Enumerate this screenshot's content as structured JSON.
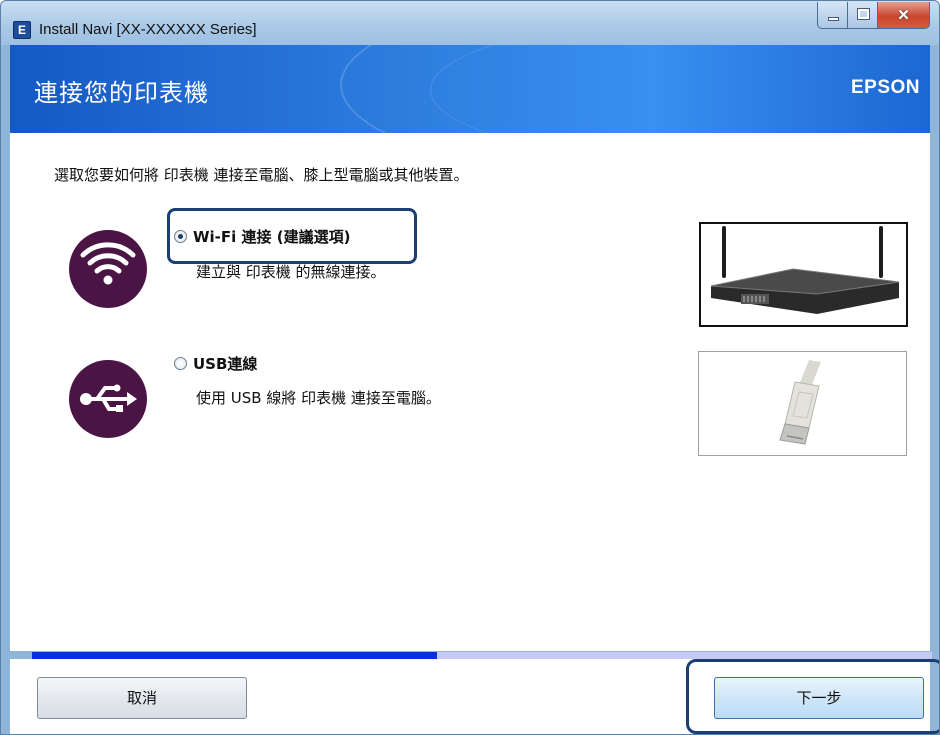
{
  "window": {
    "title": "Install Navi [XX-XXXXXX Series]",
    "app_icon_glyph": "E"
  },
  "header": {
    "title": "連接您的印表機",
    "brand": "EPSON"
  },
  "instruction": "選取您要如何將 印表機 連接至電腦、膝上型電腦或其他裝置。",
  "options": [
    {
      "id": "wifi",
      "label": "Wi-Fi 連接 (建議選項)",
      "description": "建立與 印表機 的無線連接。",
      "selected": true,
      "icon": "wifi-icon"
    },
    {
      "id": "usb",
      "label": "USB連線",
      "description": "使用 USB 線將 印表機 連接至電腦。",
      "selected": false,
      "icon": "usb-icon"
    }
  ],
  "progress": {
    "fraction": 0.45,
    "fill_color": "#0b2ee0",
    "track_color": "#c5c9f3"
  },
  "buttons": {
    "cancel": "取消",
    "next": "下一步"
  },
  "colors": {
    "header_blue": "#2e7fe0",
    "icon_circle": "#4a1545",
    "highlight": "#1b3f73"
  }
}
